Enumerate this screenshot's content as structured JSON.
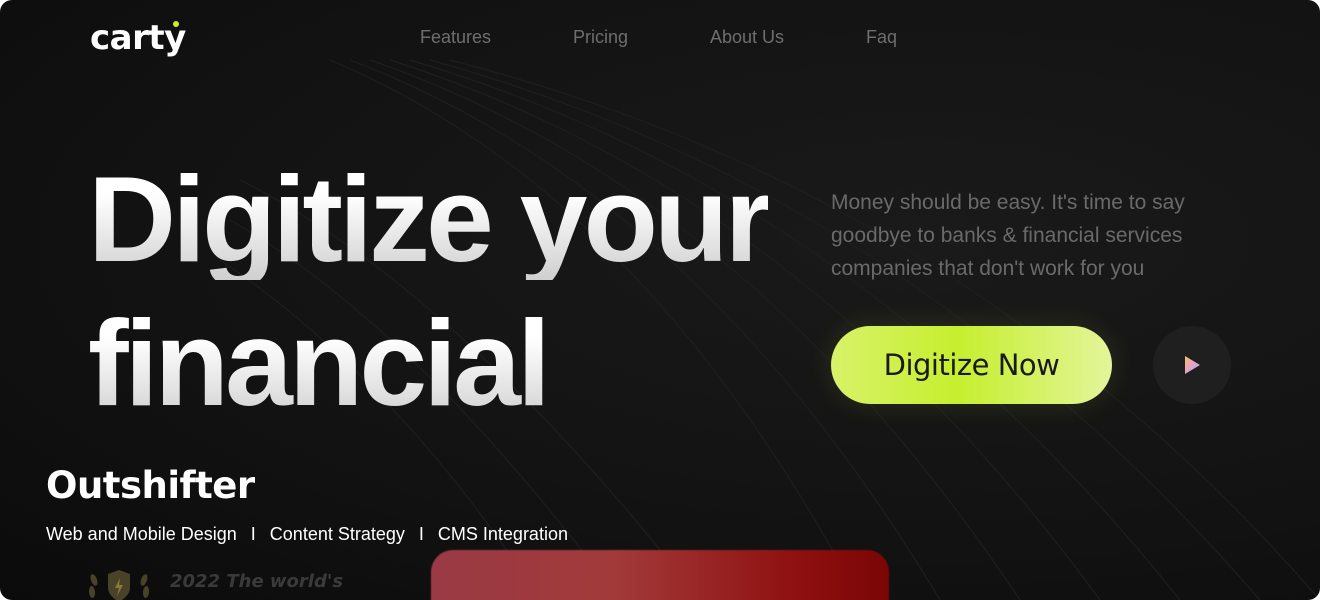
{
  "brand": {
    "logo": "carty",
    "accent_color": "#c6ef2e"
  },
  "nav": {
    "items": [
      {
        "label": "Features"
      },
      {
        "label": "Pricing"
      },
      {
        "label": "About Us"
      },
      {
        "label": "Faq"
      }
    ]
  },
  "hero": {
    "headline_line1": "Digitize your",
    "headline_line2": "financial",
    "tagline_line1": "Money should be easy. It's time to say",
    "tagline_line2": "goodbye to banks & financial services",
    "tagline_line3": "companies that don't work for you",
    "cta_label": "Digitize Now",
    "play_icon": "play-icon"
  },
  "award": {
    "icon": "laurel-shield-icon",
    "text": "2022 The world's"
  },
  "overlay": {
    "title": "Outshifter",
    "services": [
      "Web and Mobile Design",
      "Content Strategy",
      "CMS Integration"
    ],
    "separator": "I"
  }
}
